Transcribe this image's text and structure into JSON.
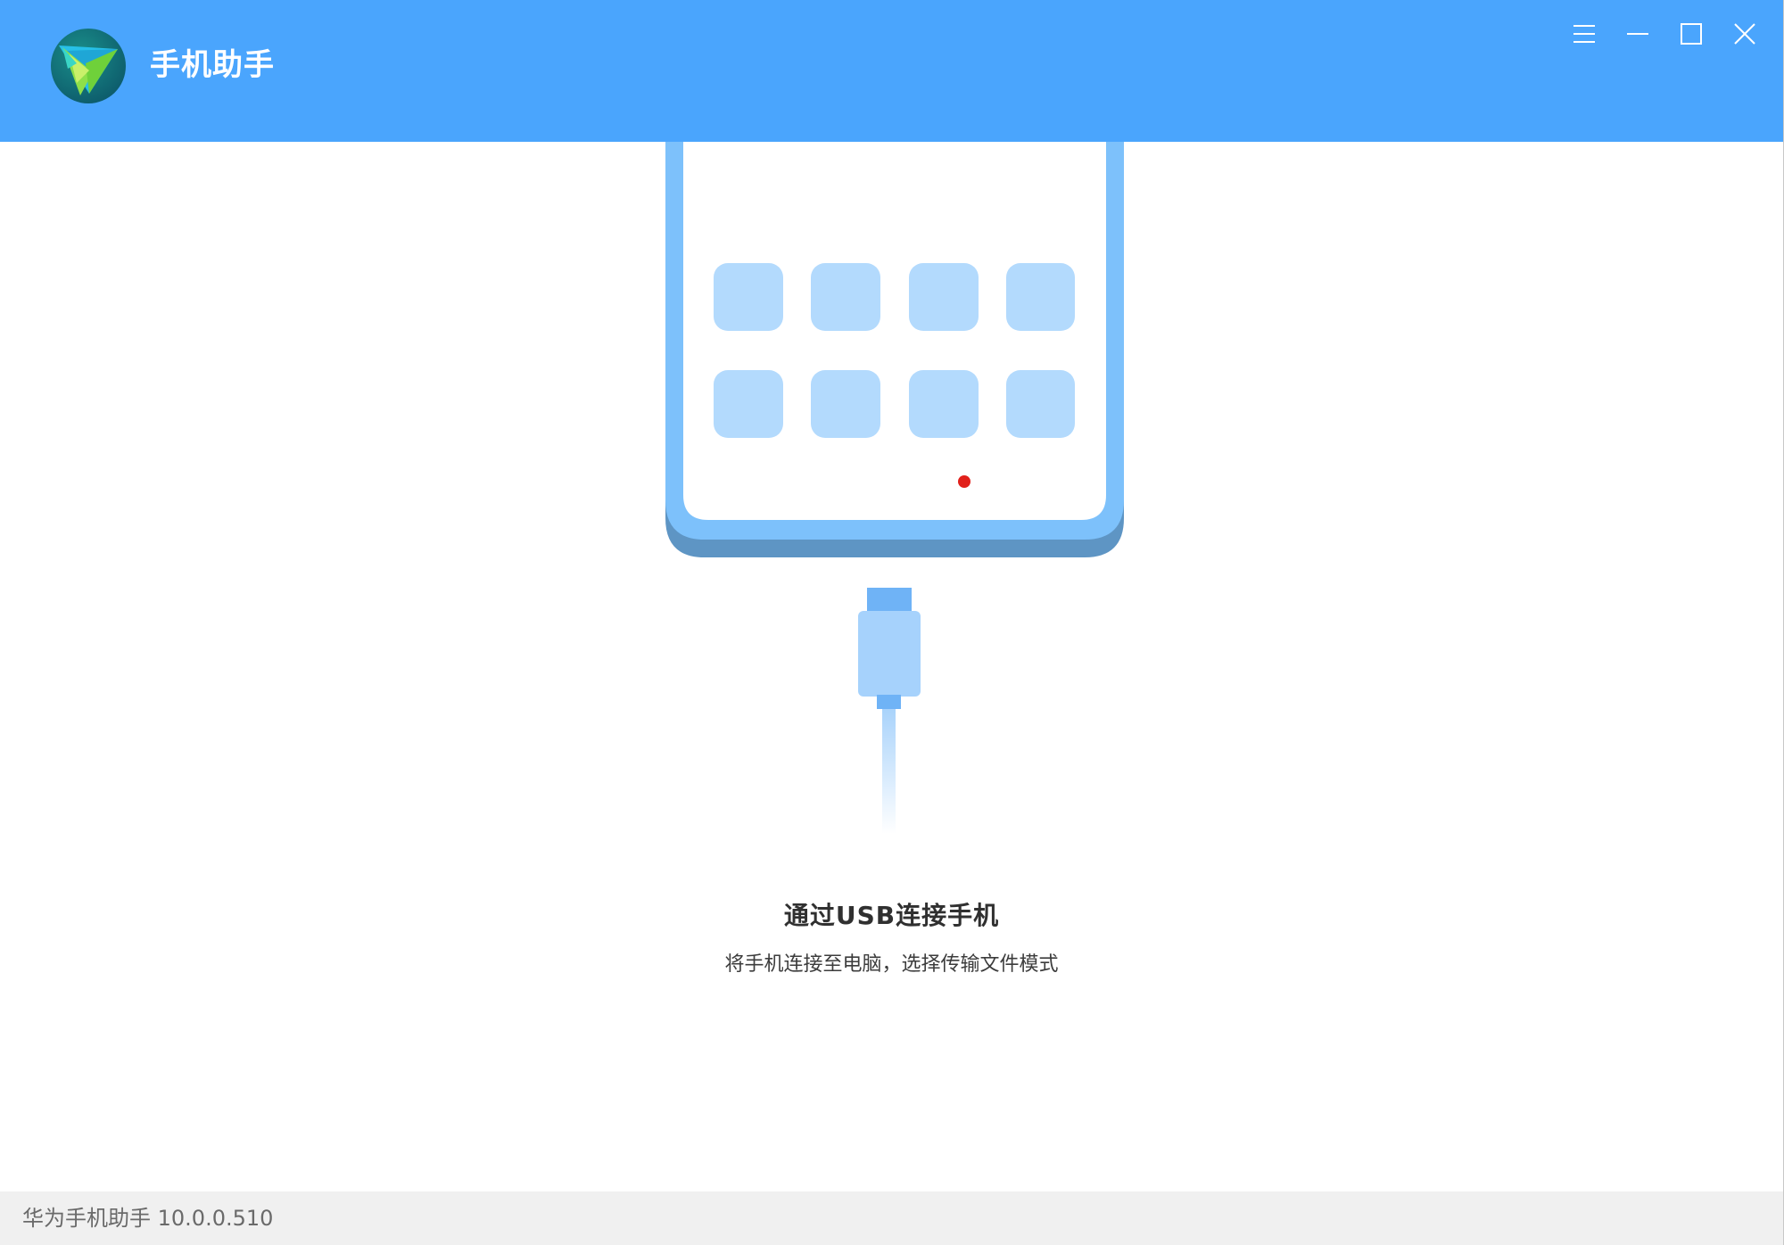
{
  "window": {
    "app_title": "手机助手",
    "icons": {
      "logo": "huawei-handset-assistant-logo",
      "menu": "hamburger-menu-icon",
      "minimize": "minimize-icon",
      "maximize": "maximize-icon",
      "close": "close-icon"
    },
    "colors": {
      "titlebar": "#4aa5fd",
      "phone_frame": "#7dc1fb",
      "phone_shadow": "#5e95c4",
      "app_tile": "#b3dafd",
      "notification_dot": "#e1201b",
      "statusbar": "#f0f0f0"
    }
  },
  "main": {
    "connect_title": "通过USB连接手机",
    "connect_subtitle": "将手机连接至电脑，选择传输文件模式"
  },
  "statusbar": {
    "version_label": "华为手机助手 10.0.0.510"
  }
}
